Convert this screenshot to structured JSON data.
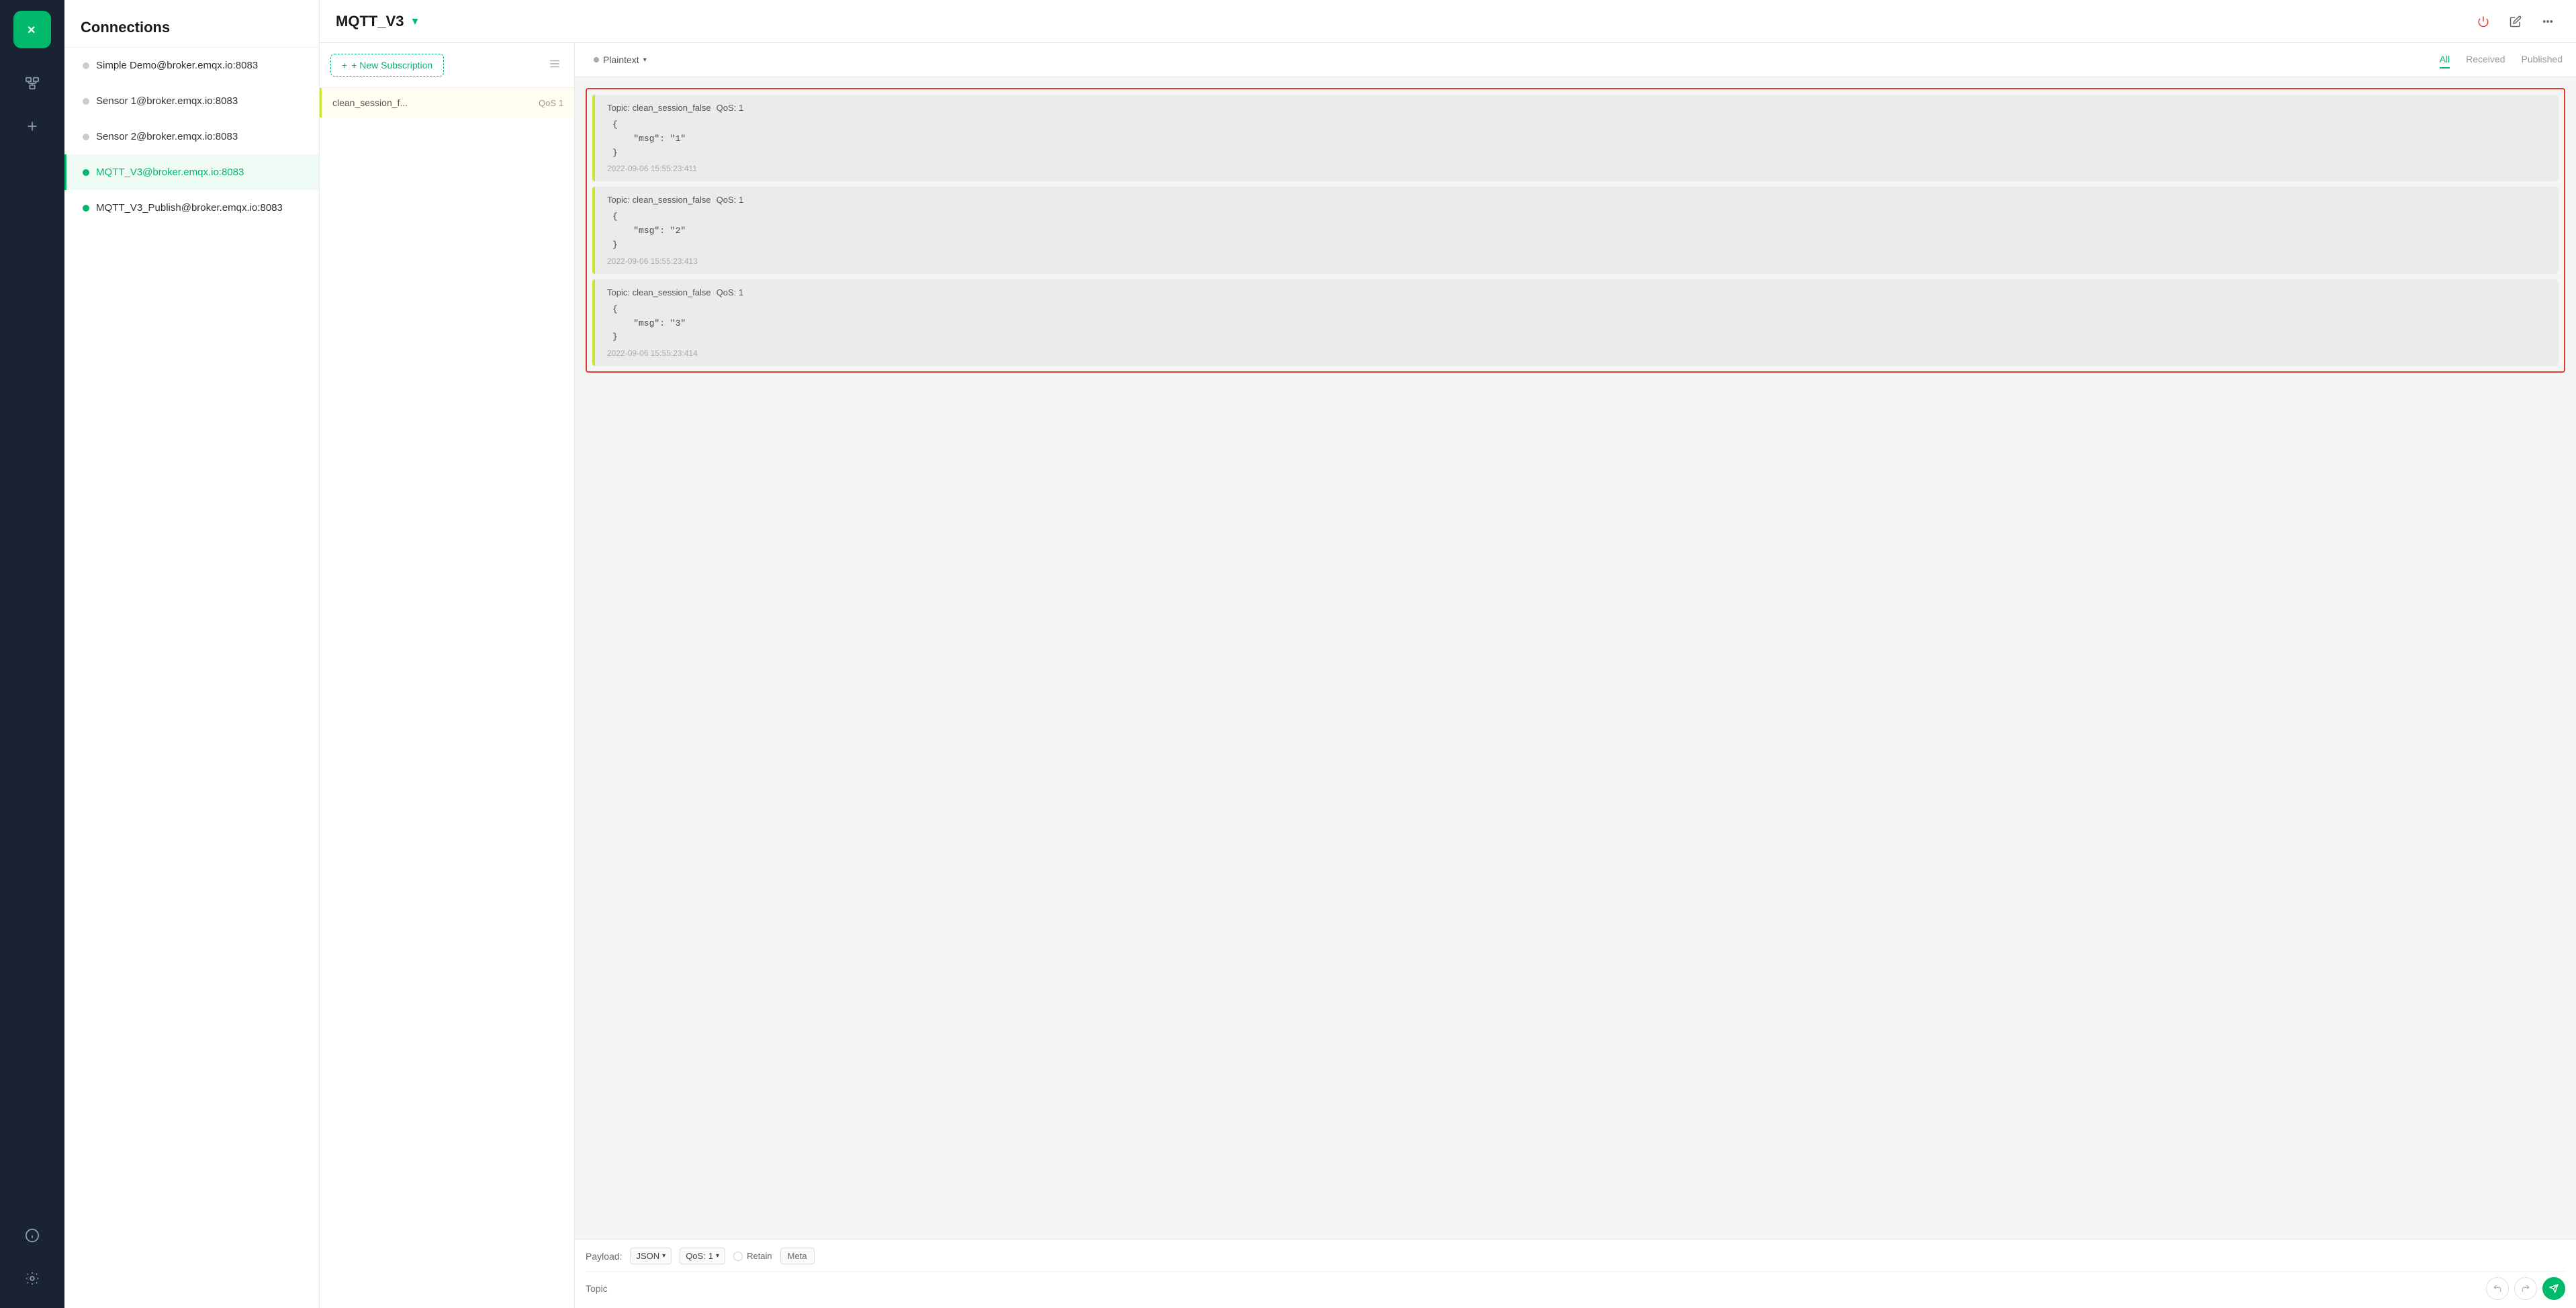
{
  "sidebar": {
    "logo_alt": "MQTTX Logo",
    "icons": [
      {
        "name": "connections-icon",
        "symbol": "⇄"
      },
      {
        "name": "plus-icon",
        "symbol": "+"
      },
      {
        "name": "info-icon",
        "symbol": "ℹ"
      },
      {
        "name": "settings-icon",
        "symbol": "⚙"
      }
    ]
  },
  "connections": {
    "title": "Connections",
    "items": [
      {
        "id": 1,
        "name": "Simple Demo@broker.emqx.io:8083",
        "status": "gray",
        "active": false
      },
      {
        "id": 2,
        "name": "Sensor 1@broker.emqx.io:8083",
        "status": "gray",
        "active": false
      },
      {
        "id": 3,
        "name": "Sensor 2@broker.emqx.io:8083",
        "status": "gray",
        "active": false
      },
      {
        "id": 4,
        "name": "MQTT_V3@broker.emqx.io:8083",
        "status": "green",
        "active": true
      },
      {
        "id": 5,
        "name": "MQTT_V3_Publish@broker.emqx.io:8083",
        "status": "green",
        "active": false
      }
    ]
  },
  "topbar": {
    "title": "MQTT_V3",
    "chevron": "▾",
    "icons": [
      {
        "name": "power-icon",
        "symbol": "⏻"
      },
      {
        "name": "edit-icon",
        "symbol": "✎"
      },
      {
        "name": "more-icon",
        "symbol": "···"
      }
    ]
  },
  "subscriptions": {
    "new_button_label": "+ New Subscription",
    "items": [
      {
        "name": "clean_session_f...",
        "qos": "QoS 1"
      }
    ]
  },
  "messages": {
    "plaintext_label": "Plaintext",
    "filter_tabs": [
      {
        "label": "All",
        "active": true
      },
      {
        "label": "Received",
        "active": false
      },
      {
        "label": "Published",
        "active": false
      }
    ],
    "items": [
      {
        "topic": "Topic: clean_session_false",
        "qos": "QoS: 1",
        "body": "{\n    \"msg\": \"1\"\n}",
        "time": "2022-09-06 15:55:23:411"
      },
      {
        "topic": "Topic: clean_session_false",
        "qos": "QoS: 1",
        "body": "{\n    \"msg\": \"2\"\n}",
        "time": "2022-09-06 15:55:23:413"
      },
      {
        "topic": "Topic: clean_session_false",
        "qos": "QoS: 1",
        "body": "{\n    \"msg\": \"3\"\n}",
        "time": "2022-09-06 15:55:23:414"
      }
    ]
  },
  "bottombar": {
    "payload_label": "Payload:",
    "format_label": "JSON",
    "qos_label": "QoS:",
    "qos_value": "1",
    "retain_label": "Retain",
    "meta_label": "Meta",
    "topic_placeholder": "Topic"
  }
}
